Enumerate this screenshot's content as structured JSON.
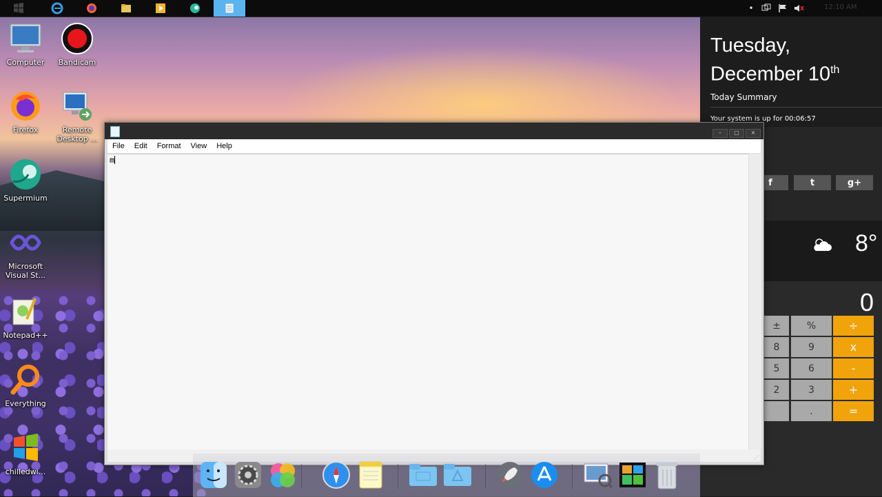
{
  "taskbar": {
    "apps": [
      "start",
      "internet-explorer",
      "firefox",
      "file-explorer",
      "media-player",
      "supermium",
      "notepad"
    ],
    "active": "notepad",
    "tray_time": "12:10 AM"
  },
  "desktop": {
    "icons": [
      {
        "label": "Computer",
        "icon": "computer-icon"
      },
      {
        "label": "Bandicam",
        "icon": "bandicam-icon"
      },
      {
        "label": "Firefox",
        "icon": "firefox-icon"
      },
      {
        "label": "Remote Desktop ...",
        "icon": "remote-desktop-icon"
      },
      {
        "label": "Supermium",
        "icon": "supermium-icon"
      },
      {
        "label": "Microsoft Visual St...",
        "icon": "visual-studio-icon"
      },
      {
        "label": "Notepad++",
        "icon": "notepadpp-icon"
      },
      {
        "label": "Everything",
        "icon": "everything-icon"
      },
      {
        "label": "chilledwi...",
        "icon": "windows-logo-icon"
      }
    ]
  },
  "panel": {
    "day_line1": "Tuesday,",
    "day_line2": "December 10",
    "day_sup": "th",
    "summary": "Today Summary",
    "uptime": "Your system is up for 00:06:57",
    "social": [
      "f",
      "t",
      "g+"
    ],
    "weather_icon": "cloud-sun-icon",
    "temperature": "8°"
  },
  "calculator": {
    "display": "0",
    "rows": [
      [
        "±",
        "%",
        "÷"
      ],
      [
        "8",
        "9",
        "x"
      ],
      [
        "5",
        "6",
        "-"
      ],
      [
        "2",
        "3",
        "+"
      ],
      [
        "",
        ".",
        "="
      ]
    ],
    "op_color": "#f0a30a"
  },
  "notepad": {
    "title": "",
    "menu": [
      "File",
      "Edit",
      "Format",
      "View",
      "Help"
    ],
    "content": "m",
    "buttons": [
      "–",
      "□",
      "×"
    ]
  },
  "dock": {
    "items": [
      "finder-icon",
      "system-preferences-icon",
      "game-center-icon",
      "safari-icon",
      "notes-icon",
      "folder-icon",
      "applications-folder-icon",
      "launchpad-icon",
      "app-store-icon",
      "preview-icon",
      "photo-booth-icon",
      "trash-icon"
    ]
  }
}
